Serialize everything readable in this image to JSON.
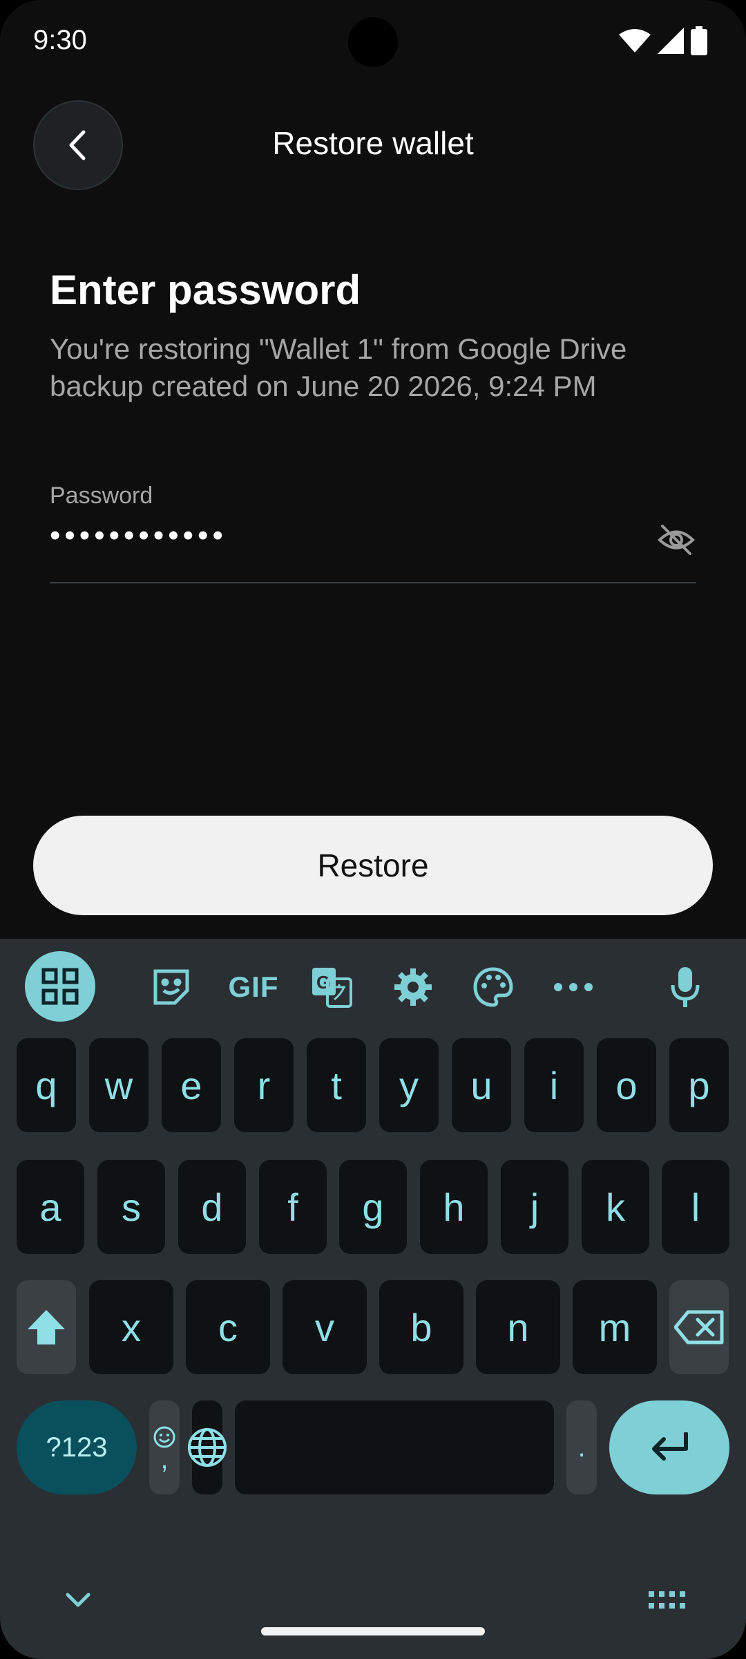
{
  "status": {
    "time": "9:30"
  },
  "appbar": {
    "title": "Restore wallet"
  },
  "main": {
    "heading": "Enter password",
    "subtitle": "You're restoring \"Wallet 1\" from Google Drive backup created on June 20 2026, 9:24 PM",
    "password_label": "Password",
    "password_value": "••••••••••••",
    "restore_label": "Restore"
  },
  "keyboard": {
    "toolbar": {
      "gif_label": "GIF"
    },
    "row1": [
      "q",
      "w",
      "e",
      "r",
      "t",
      "y",
      "u",
      "i",
      "o",
      "p"
    ],
    "row2": [
      "a",
      "s",
      "d",
      "f",
      "g",
      "h",
      "j",
      "k",
      "l"
    ],
    "row3": [
      "x",
      "c",
      "v",
      "b",
      "n",
      "m"
    ],
    "symbols_label": "?123",
    "comma_label": ",",
    "period_label": "."
  },
  "colors": {
    "accent": "#7fd0d6",
    "key_text": "#8fe0e6",
    "background": "#0e0e0e",
    "keyboard_bg": "#2a2f33"
  }
}
